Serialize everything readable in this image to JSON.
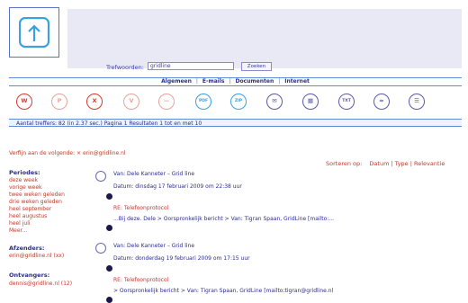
{
  "search": {
    "label": "Trefwoorden:",
    "value": "gridline",
    "button_label": "Zoeken"
  },
  "tabs": [
    "Algemeen",
    "E-mails",
    "Documenten",
    "Internet"
  ],
  "file_icons": [
    {
      "name": "word-icon",
      "glyph": "W",
      "color": "#d83b2f"
    },
    {
      "name": "powerpoint-icon",
      "glyph": "P",
      "color": "#e8a39a"
    },
    {
      "name": "excel-icon",
      "glyph": "X",
      "color": "#d83b2f"
    },
    {
      "name": "visio-icon",
      "glyph": "V",
      "color": "#e8a39a"
    },
    {
      "name": "generic-file-icon",
      "glyph": "—",
      "color": "#e8a39a"
    },
    {
      "name": "pdf-icon",
      "glyph": "PDF",
      "color": "#3aa0e0"
    },
    {
      "name": "zip-icon",
      "glyph": "ZIP",
      "color": "#3aa0e0"
    },
    {
      "name": "email-icon",
      "glyph": "✉",
      "color": "#5a5aa8"
    },
    {
      "name": "calendar-icon",
      "glyph": "▦",
      "color": "#5a5aa8"
    },
    {
      "name": "text-file-icon",
      "glyph": "TXT",
      "color": "#5a5aa8"
    },
    {
      "name": "web-icon",
      "glyph": "≈",
      "color": "#5a5aa8"
    },
    {
      "name": "chat-icon",
      "glyph": "☰",
      "color": "#5a5aa8"
    }
  ],
  "stats": {
    "text": "Aantal treffers: 82 (in 2.37 sec.) Pagina 1 Resultaten 1 tot en met 10"
  },
  "filter": {
    "text": "Verfijn aan de volgende:  × erin@gridline.nl"
  },
  "sort": {
    "label": "Sorteren op:",
    "options": [
      "Datum",
      "Type",
      "Relevantie"
    ]
  },
  "sidebar": {
    "periods_title": "Periodes:",
    "periods": [
      "deze week",
      "vorige week",
      "twee weken geleden",
      "drie weken geleden",
      "heel september",
      "heel augustus",
      "heel juli",
      "Meer..."
    ],
    "senders_title": "Afzenders:",
    "senders": [
      "erin@gridline.nl (xx)"
    ],
    "recipients_title": "Ontvangers:",
    "recipients": [
      "dennis@gridline.nl (12)"
    ]
  },
  "results": [
    {
      "from": "Van: Dele Kanneter – Grid line",
      "date": "Datum: dinsdag 17 februari 2009 om 22:38 uur",
      "subject": "RE: Telefoonprotocol",
      "snippet": "...Bij deze. Dele >       Oorspronkelijk bericht      > Van: Tigran Spaan, GridLine [mailto:..."
    },
    {
      "from": "Van: Dele Kanneter – Grid line",
      "date": "Datum: donderdag 19 februari 2009 om 17:15 uur",
      "subject": "RE: Telefoonprotocol",
      "snippet": ">       Oorspronkelijk bericht      > Van: Tigran Spaan, GridLine [mailto:tigran@gridline.nl"
    }
  ]
}
